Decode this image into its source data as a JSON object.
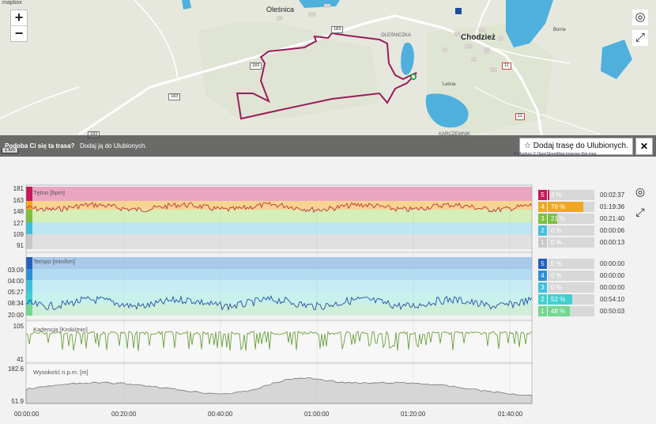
{
  "map": {
    "logo": "mapbox",
    "places": {
      "olesnica": "Oleśnica",
      "chodziez": "Chodzież",
      "olesniczka": "OLEŚNICZKA",
      "karczewnik": "KARCZEWNIK",
      "lesna": "Leśna",
      "borne": "Borne"
    },
    "roads": {
      "r183a": "183",
      "r183b": "183",
      "r183c": "183",
      "r183d": "183",
      "r11a": "11",
      "r11b": "11"
    },
    "scale": "1 km",
    "attribution": "© Mapbox © OpenStreetMap Improve this map",
    "zoom_in": "+",
    "zoom_out": "−",
    "route_color": "#9b1b5a"
  },
  "promo": {
    "question": "Podoba Ci się ta trasa?",
    "action": "Dodaj ją do Ulubionych.",
    "fav_button": "Dodaj trasę do Ulubionych.",
    "close": "✕"
  },
  "charts": {
    "hr": {
      "label": "Tętno [bpm]",
      "ticks": [
        "181",
        "163",
        "148",
        "127",
        "109",
        "91"
      ],
      "zones": [
        {
          "num": "5",
          "pct": "3 %",
          "frac": 0.03,
          "time": "00:02:37",
          "color": "#c8185a"
        },
        {
          "num": "4",
          "pct": "76 %",
          "frac": 0.76,
          "time": "01:19:36",
          "color": "#f0a820"
        },
        {
          "num": "3",
          "pct": "21 %",
          "frac": 0.21,
          "time": "00:21:40",
          "color": "#7cc040"
        },
        {
          "num": "2",
          "pct": "0 %",
          "frac": 0.0,
          "time": "00:00:06",
          "color": "#40c0e0"
        },
        {
          "num": "1",
          "pct": "0 %",
          "frac": 0.0,
          "time": "00:00:13",
          "color": "#c8c8c8"
        }
      ]
    },
    "pace": {
      "label": "Tempo [min/km]",
      "ticks": [
        "03:09",
        "04:00",
        "05:27",
        "08:34",
        "20:00"
      ],
      "zones": [
        {
          "num": "5",
          "pct": "0 %",
          "frac": 0.0,
          "time": "00:00:00",
          "color": "#2060c0"
        },
        {
          "num": "4",
          "pct": "0 %",
          "frac": 0.0,
          "time": "00:00:00",
          "color": "#2a90d8"
        },
        {
          "num": "3",
          "pct": "0 %",
          "frac": 0.0,
          "time": "00:00:00",
          "color": "#40c0e0"
        },
        {
          "num": "2",
          "pct": "52 %",
          "frac": 0.52,
          "time": "00:54:10",
          "color": "#40d0d0"
        },
        {
          "num": "1",
          "pct": "48 %",
          "frac": 0.48,
          "time": "00:50:03",
          "color": "#70d890"
        }
      ]
    },
    "cadence": {
      "label": "Kadencja [Kroki/min]",
      "ticks": [
        "105",
        "41"
      ]
    },
    "altitude": {
      "label": "Wysokość n.p.m. [m]",
      "ticks": [
        "182.6",
        "51.9"
      ]
    },
    "x_ticks": [
      "00:00:00",
      "00:20:00",
      "00:40:00",
      "01:00:00",
      "01:20:00",
      "01:40:00"
    ]
  },
  "icons": {
    "settings": "target-icon",
    "fullscreen": "expand-icon"
  }
}
